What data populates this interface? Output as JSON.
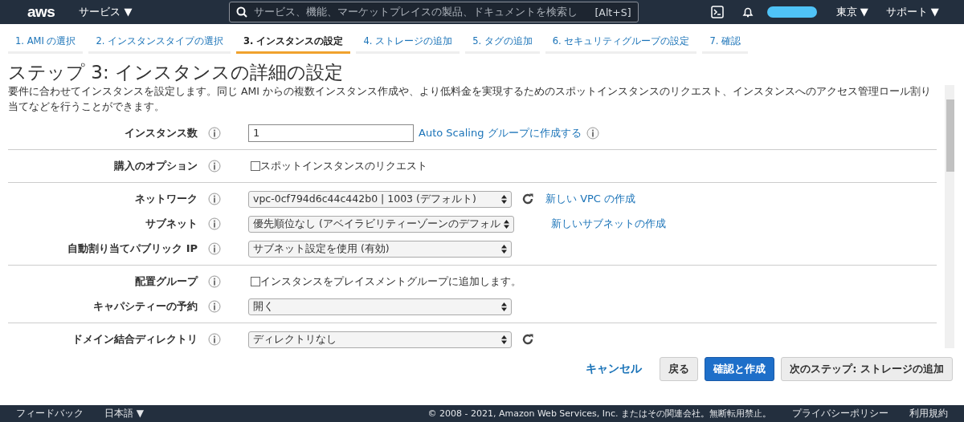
{
  "header": {
    "logo": "aws",
    "services": "サービス ▼",
    "search_placeholder": "サービス、機能、マーケットプレイスの製品、ドキュメントを検索し",
    "search_shortcut": "[Alt+S]",
    "region": "東京 ▼",
    "support": "サポート ▼"
  },
  "steps": [
    {
      "label": "1. AMI の選択",
      "selected": false
    },
    {
      "label": "2. インスタンスタイプの選択",
      "selected": false
    },
    {
      "label": "3. インスタンスの設定",
      "selected": true
    },
    {
      "label": "4. ストレージの追加",
      "selected": false
    },
    {
      "label": "5. タグの追加",
      "selected": false
    },
    {
      "label": "6. セキュリティグループの設定",
      "selected": false
    },
    {
      "label": "7. 確認",
      "selected": false
    }
  ],
  "title": "ステップ 3: インスタンスの詳細の設定",
  "description": "要件に合わせてインスタンスを設定します。同じ AMI からの複数インスタンス作成や、より低料金を実現するためのスポットインスタンスのリクエスト、インスタンスへのアクセス管理ロール割り当てなどを行うことができます。",
  "sections": [
    {
      "rows": [
        {
          "label": "インスタンス数",
          "kind": "input",
          "value": "1",
          "link": "Auto Scaling グループに作成する",
          "link_info": true
        }
      ]
    },
    {
      "rows": [
        {
          "label": "購入のオプション",
          "kind": "checkbox",
          "checked": false,
          "value": "スポットインスタンスのリクエスト"
        }
      ]
    },
    {
      "rows": [
        {
          "label": "ネットワーク",
          "kind": "select",
          "value": "vpc-0cf794d6c44c442b0 | 1003 (デフォルト)",
          "refresh": true,
          "link": "新しい VPC の作成"
        },
        {
          "label": "サブネット",
          "kind": "select",
          "value": "優先順位なし (アベイラビリティーゾーンのデフォル",
          "link": "新しいサブネットの作成"
        },
        {
          "label": "自動割り当てパブリック IP",
          "kind": "select",
          "value": "サブネット設定を使用 (有効)"
        }
      ]
    },
    {
      "rows": [
        {
          "label": "配置グループ",
          "kind": "checkbox",
          "checked": false,
          "value": "インスタンスをプレイスメントグループに追加します。"
        },
        {
          "label": "キャパシティーの予約",
          "kind": "select",
          "value": "開く"
        }
      ]
    },
    {
      "rows": [
        {
          "label": "ドメイン結合ディレクトリ",
          "kind": "select",
          "value": "ディレクトリなし",
          "refresh": true
        }
      ]
    }
  ],
  "buttons": [
    {
      "kind": "link",
      "label": "キャンセル"
    },
    {
      "kind": "secondary",
      "label": "戻る"
    },
    {
      "kind": "primary",
      "label": "確認と作成"
    },
    {
      "kind": "secondary",
      "label": "次のステップ: ストレージの追加"
    }
  ],
  "footer": {
    "feedback": "フィードバック",
    "language": "日本語 ▼",
    "copyright": "© 2008 - 2021, Amazon Web Services, Inc. またはその関連会社。無断転用禁止。",
    "privacy": "プライバシーポリシー",
    "terms": "利用規約"
  }
}
